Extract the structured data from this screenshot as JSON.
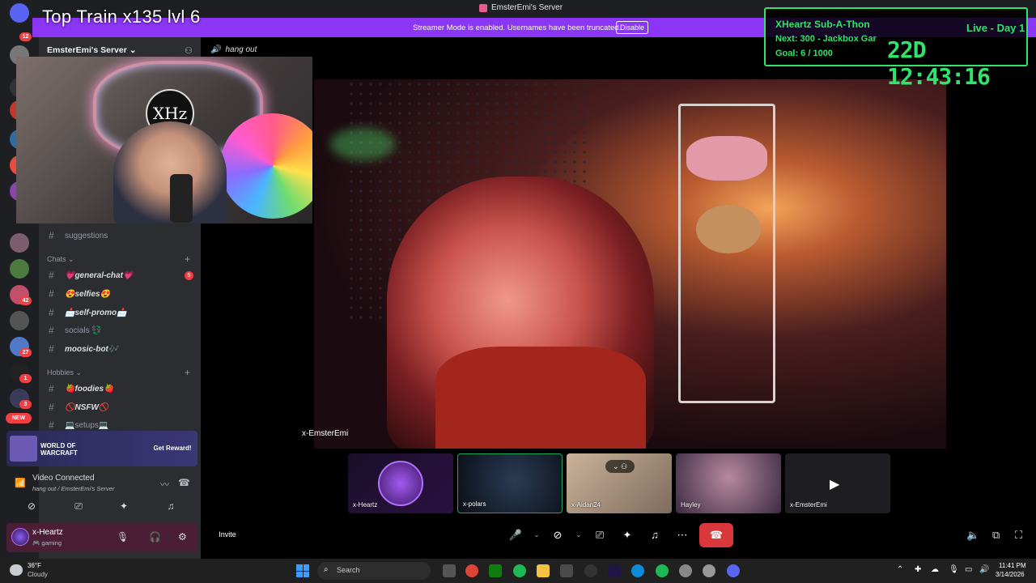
{
  "window": {
    "title": "EmsterEmi's Server"
  },
  "overlay": {
    "train": "Top Train   x135   lvl 6"
  },
  "banner": {
    "text": "Streamer Mode is enabled. Usernames have been truncated.",
    "button": "Disable"
  },
  "server": {
    "name": "EmsterEmi's Server ⌄",
    "voice_channel": "hang out"
  },
  "rail": {
    "badges": [
      "12",
      "42",
      "27",
      "1",
      "3"
    ],
    "new_label": "NEW"
  },
  "categories": {
    "chats": "Chats ⌄",
    "hobbies": "Hobbies ⌄"
  },
  "channels": {
    "suggestions": "suggestions",
    "general": "💗general-chat💗",
    "selfies": "😍selfies😍",
    "selfpromo": "📩self-promo📩",
    "socials": "socials 💱",
    "moosic": "moosic-bot🎶",
    "foodies": "🍓foodies🍓",
    "nsfw": "🚫NSFW🚫",
    "setups": "💻setups💻"
  },
  "general_badge": "5",
  "promo": {
    "title": "WORLD OF\nWARCRAFT",
    "button": "Get Reward!"
  },
  "voice": {
    "status": "Video Connected",
    "location": "hang out / EmsterEmi's Server"
  },
  "user": {
    "name": "x-Heartz",
    "status": "🎮 gaming"
  },
  "stage": {
    "main_label": "x-EmsterEmi",
    "tiles": [
      "x-Heartz",
      "x-polars",
      "x-Aidan24",
      "Hayley",
      "x-EmsterEmi"
    ],
    "invite": "Invite"
  },
  "timer": {
    "title": "XHeartz Sub-A-Thon",
    "next": "Next: 300 - Jackbox Gar",
    "goal": "Goal: 6 / 1000",
    "live": "Live - Day 1",
    "clock": "22D 12:43:16"
  },
  "taskbar": {
    "temp": "36°F",
    "condition": "Cloudy",
    "search": "Search",
    "time": "11:41 PM",
    "date": "3/14/2026"
  },
  "colors": {
    "banner": "#8b35f5",
    "timer_green": "#31e36a",
    "leave_red": "#da373c",
    "sidebar": "#2b2d31"
  }
}
